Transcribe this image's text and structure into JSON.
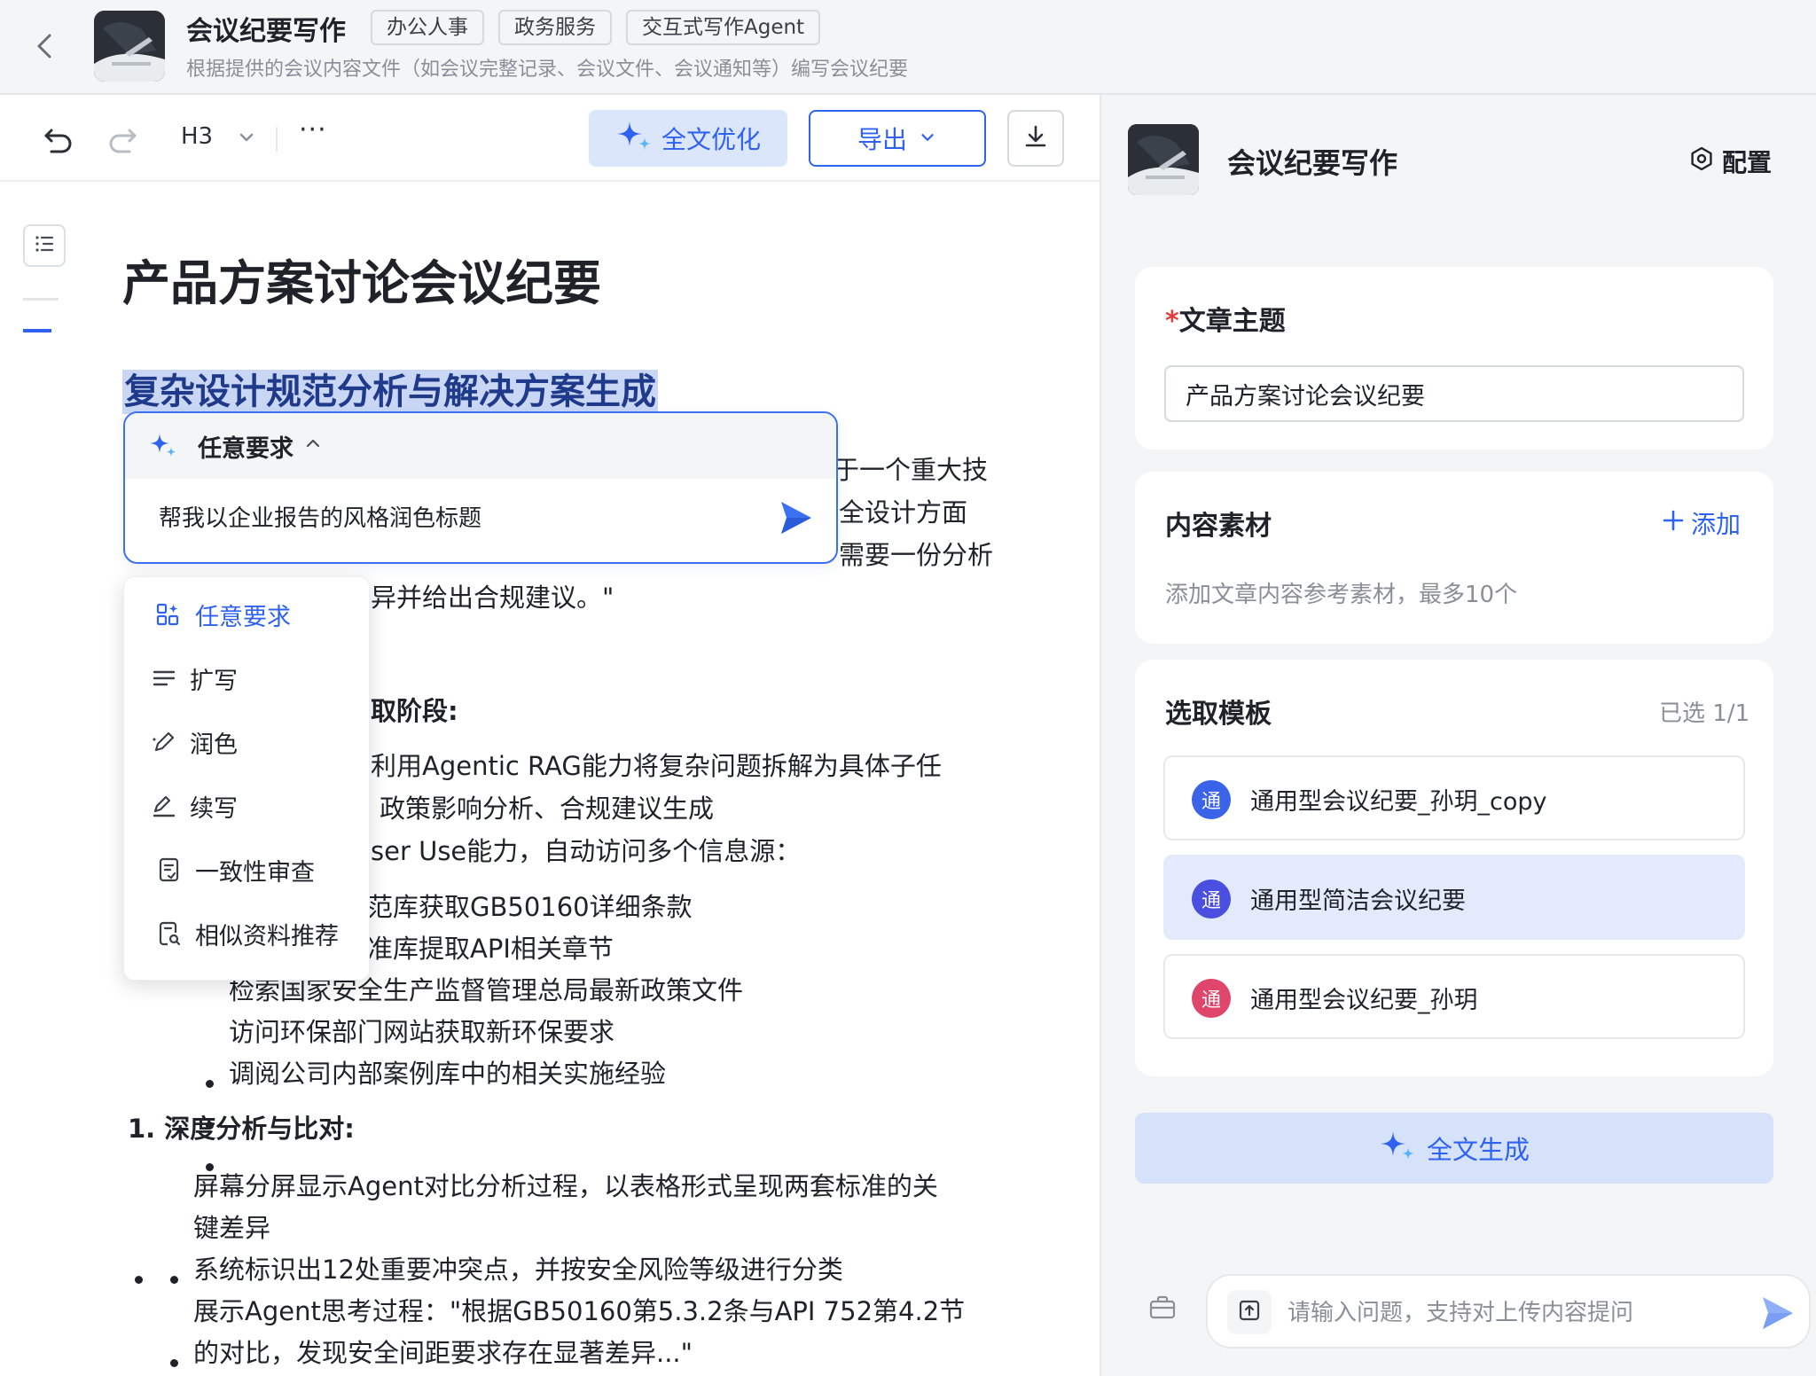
{
  "header": {
    "title": "会议纪要写作",
    "tags": [
      "办公人事",
      "政务服务",
      "交互式写作Agent"
    ],
    "description": "根据提供的会议内容文件（如会议完整记录、会议文件、会议通知等）编写会议纪要"
  },
  "toolbar": {
    "heading_level": "H3",
    "more": "···",
    "optimize_label": "全文优化",
    "export_label": "导出"
  },
  "document": {
    "title": "产品方案讨论会议纪要",
    "selected_heading": "复杂设计规范分析与解决方案生成",
    "visible_text": {
      "line1": "于一个重大技",
      "line2": "全设计方面",
      "line3": "需要一份分析",
      "line4": "异并给出合规建议。\"",
      "stage_heading": "取阶段:",
      "l_rag": "利用Agentic RAG能力将复杂问题拆解为具体子任",
      "l_policy": "政策影响分析、合规建议生成",
      "l_browser": "ser Use能力，自动访问多个信息源：",
      "b1": "范库获取GB50160详细条款",
      "b2": "准库提取API相关章节",
      "b3": "检索国家安全生产监督管理总局最新政策文件",
      "b4": "访问环保部门网站获取新环保要求",
      "b5": "调阅公司内部案例库中的相关实施经验",
      "section2": "1. 深度分析与比对:",
      "c1a": "屏幕分屏显示Agent对比分析过程，以表格形式呈现两套标准的关",
      "c1b": "键差异",
      "c2": "系统标识出12处重要冲突点，并按安全风险等级进行分类",
      "c3": "展示Agent思考过程：\"根据GB50160第5.3.2条与API 752第4.2节",
      "c4": "的对比，发现安全间距要求存在显著差异...\""
    }
  },
  "ai_popup": {
    "mode_label": "任意要求",
    "input_text": "帮我以企业报告的风格润色标题"
  },
  "menu": {
    "items": [
      {
        "label": "任意要求",
        "icon": "grid-sparkle-icon"
      },
      {
        "label": "扩写",
        "icon": "lines-icon"
      },
      {
        "label": "润色",
        "icon": "pen-sparkle-icon"
      },
      {
        "label": "续写",
        "icon": "pen-line-icon"
      },
      {
        "label": "一致性审查",
        "icon": "doc-check-icon"
      },
      {
        "label": "相似资料推荐",
        "icon": "doc-search-icon"
      }
    ]
  },
  "panel": {
    "title": "会议纪要写作",
    "config_label": "配置",
    "topic": {
      "label": "文章主题",
      "required_mark": "*",
      "value": "产品方案讨论会议纪要"
    },
    "materials": {
      "label": "内容素材",
      "add_label": "添加",
      "hint": "添加文章内容参考素材，最多10个"
    },
    "templates": {
      "label": "选取模板",
      "selected_count": "已选 1/1",
      "items": [
        {
          "badge": "通",
          "name": "通用型会议纪要_孙玥_copy",
          "color": "#3b63e8"
        },
        {
          "badge": "通",
          "name": "通用型简洁会议纪要",
          "color": "#4a4fe0"
        },
        {
          "badge": "通",
          "name": "通用型会议纪要_孙玥",
          "color": "#e0456b"
        }
      ]
    },
    "generate_label": "全文生成",
    "chat_placeholder": "请输入问题，支持对上传内容提问"
  },
  "colors": {
    "accent": "#2f62f0",
    "highlight": "#c9d7f5",
    "selected_template_bg": "#e3eafb"
  }
}
